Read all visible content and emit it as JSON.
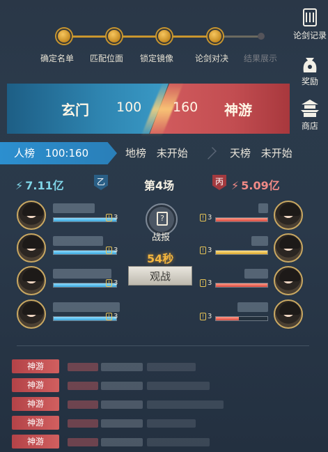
{
  "progress": {
    "steps": [
      {
        "label": "确定名单",
        "done": true
      },
      {
        "label": "匹配位面",
        "done": true
      },
      {
        "label": "锁定镜像",
        "done": true
      },
      {
        "label": "论剑对决",
        "done": true
      },
      {
        "label": "结果展示",
        "done": false
      }
    ]
  },
  "side_menu": [
    {
      "label": "论剑记录",
      "icon": "scroll-icon"
    },
    {
      "label": "奖励",
      "icon": "reward-bag-icon"
    },
    {
      "label": "商店",
      "icon": "pagoda-shop-icon"
    }
  ],
  "banner": {
    "left_team": "玄门",
    "left_score": "100",
    "right_score": "160",
    "right_team": "神游"
  },
  "tabs": [
    {
      "label": "人榜",
      "value": "100:160",
      "active": true
    },
    {
      "label": "地榜",
      "value": "未开始",
      "active": false
    },
    {
      "label": "天榜",
      "value": "未开始",
      "active": false
    }
  ],
  "match": {
    "left_power": "7.11亿",
    "left_group": "乙",
    "round_title": "第4场",
    "right_group": "丙",
    "right_power": "5.09亿",
    "report_label": "战报",
    "countdown": "54秒",
    "watch_label": "观战"
  },
  "left_players": [
    {
      "level": "3",
      "hp": 1.0
    },
    {
      "level": "3",
      "hp": 1.0
    },
    {
      "level": "3",
      "hp": 1.0
    },
    {
      "level": "3",
      "hp": 1.0
    }
  ],
  "right_players": [
    {
      "level": "3",
      "hp": 1.0,
      "color": "red"
    },
    {
      "level": "3",
      "hp": 1.0,
      "color": "yellow"
    },
    {
      "level": "3",
      "hp": 1.0,
      "color": "red"
    },
    {
      "level": "3",
      "hp": 0.45,
      "color": "red"
    }
  ],
  "log": [
    {
      "tag": "神游"
    },
    {
      "tag": "神游"
    },
    {
      "tag": "神游"
    },
    {
      "tag": "神游"
    },
    {
      "tag": "神游"
    }
  ],
  "colors": {
    "accent_gold": "#c9962e",
    "team_blue": "#2f86b2",
    "team_red": "#c24d51",
    "countdown": "#f2b53e"
  }
}
